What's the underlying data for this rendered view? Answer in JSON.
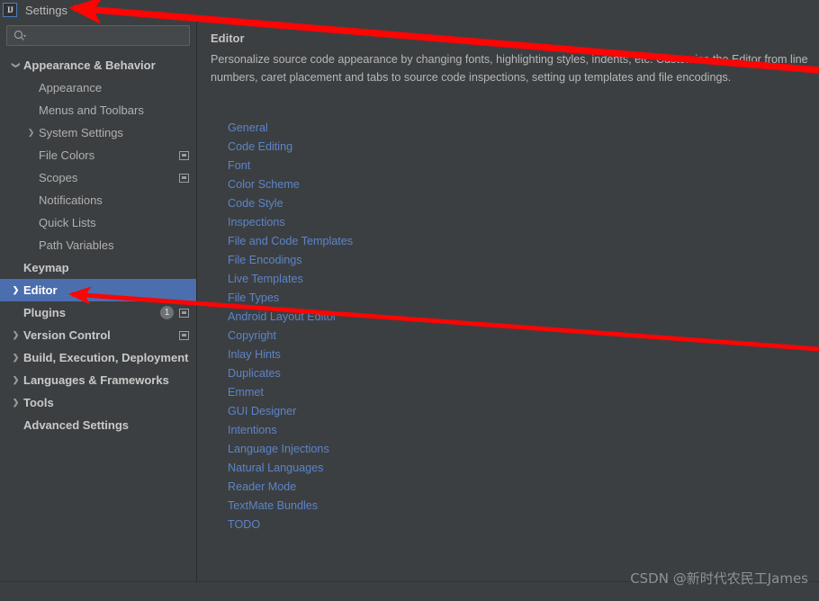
{
  "window": {
    "title": "Settings",
    "app_icon": "intellij-idea-icon"
  },
  "search": {
    "placeholder": "",
    "value": "",
    "icon": "search-icon"
  },
  "sidebar": {
    "items": [
      {
        "label": "Appearance & Behavior",
        "level": 0,
        "bold": true,
        "chevron": "down",
        "selected": false,
        "badge": null,
        "project_icon": false
      },
      {
        "label": "Appearance",
        "level": 1,
        "bold": false,
        "chevron": "none",
        "selected": false,
        "badge": null,
        "project_icon": false
      },
      {
        "label": "Menus and Toolbars",
        "level": 1,
        "bold": false,
        "chevron": "none",
        "selected": false,
        "badge": null,
        "project_icon": false
      },
      {
        "label": "System Settings",
        "level": 1,
        "bold": false,
        "chevron": "right",
        "selected": false,
        "badge": null,
        "project_icon": false
      },
      {
        "label": "File Colors",
        "level": 1,
        "bold": false,
        "chevron": "none",
        "selected": false,
        "badge": null,
        "project_icon": true
      },
      {
        "label": "Scopes",
        "level": 1,
        "bold": false,
        "chevron": "none",
        "selected": false,
        "badge": null,
        "project_icon": true
      },
      {
        "label": "Notifications",
        "level": 1,
        "bold": false,
        "chevron": "none",
        "selected": false,
        "badge": null,
        "project_icon": false
      },
      {
        "label": "Quick Lists",
        "level": 1,
        "bold": false,
        "chevron": "none",
        "selected": false,
        "badge": null,
        "project_icon": false
      },
      {
        "label": "Path Variables",
        "level": 1,
        "bold": false,
        "chevron": "none",
        "selected": false,
        "badge": null,
        "project_icon": false
      },
      {
        "label": "Keymap",
        "level": 0,
        "bold": true,
        "chevron": "none",
        "selected": false,
        "badge": null,
        "project_icon": false
      },
      {
        "label": "Editor",
        "level": 0,
        "bold": true,
        "chevron": "right",
        "selected": true,
        "badge": null,
        "project_icon": false
      },
      {
        "label": "Plugins",
        "level": 0,
        "bold": true,
        "chevron": "none",
        "selected": false,
        "badge": "1",
        "project_icon": true
      },
      {
        "label": "Version Control",
        "level": 0,
        "bold": true,
        "chevron": "right",
        "selected": false,
        "badge": null,
        "project_icon": true
      },
      {
        "label": "Build, Execution, Deployment",
        "level": 0,
        "bold": true,
        "chevron": "right",
        "selected": false,
        "badge": null,
        "project_icon": false
      },
      {
        "label": "Languages & Frameworks",
        "level": 0,
        "bold": true,
        "chevron": "right",
        "selected": false,
        "badge": null,
        "project_icon": false
      },
      {
        "label": "Tools",
        "level": 0,
        "bold": true,
        "chevron": "right",
        "selected": false,
        "badge": null,
        "project_icon": false
      },
      {
        "label": "Advanced Settings",
        "level": 0,
        "bold": true,
        "chevron": "none",
        "selected": false,
        "badge": null,
        "project_icon": false
      }
    ]
  },
  "content": {
    "title": "Editor",
    "description": "Personalize source code appearance by changing fonts, highlighting styles, indents, etc. Customize the Editor from line\nnumbers, caret placement and tabs to source code inspections, setting up templates and file encodings.",
    "links": [
      "General",
      "Code Editing",
      "Font",
      "Color Scheme",
      "Code Style",
      "Inspections",
      "File and Code Templates",
      "File Encodings",
      "Live Templates",
      "File Types",
      "Android Layout Editor",
      "Copyright",
      "Inlay Hints",
      "Duplicates",
      "Emmet",
      "GUI Designer",
      "Intentions",
      "Language Injections",
      "Natural Languages",
      "Reader Mode",
      "TextMate Bundles",
      "TODO"
    ]
  },
  "watermark": {
    "text": "CSDN @新时代农民工James"
  },
  "annotations": {
    "arrow_color": "#fb0505",
    "arrows": [
      {
        "name": "arrow-to-settings-title",
        "points_to": "Settings"
      },
      {
        "name": "arrow-to-editor-sidebar-item",
        "points_to": "Editor"
      }
    ]
  },
  "colors": {
    "window_bg": "#3c3f41",
    "content_bg": "#3c3f41",
    "selection_blue": "#4b6eaf",
    "link_blue": "#5c84c8",
    "text": "#bbbbbb"
  }
}
